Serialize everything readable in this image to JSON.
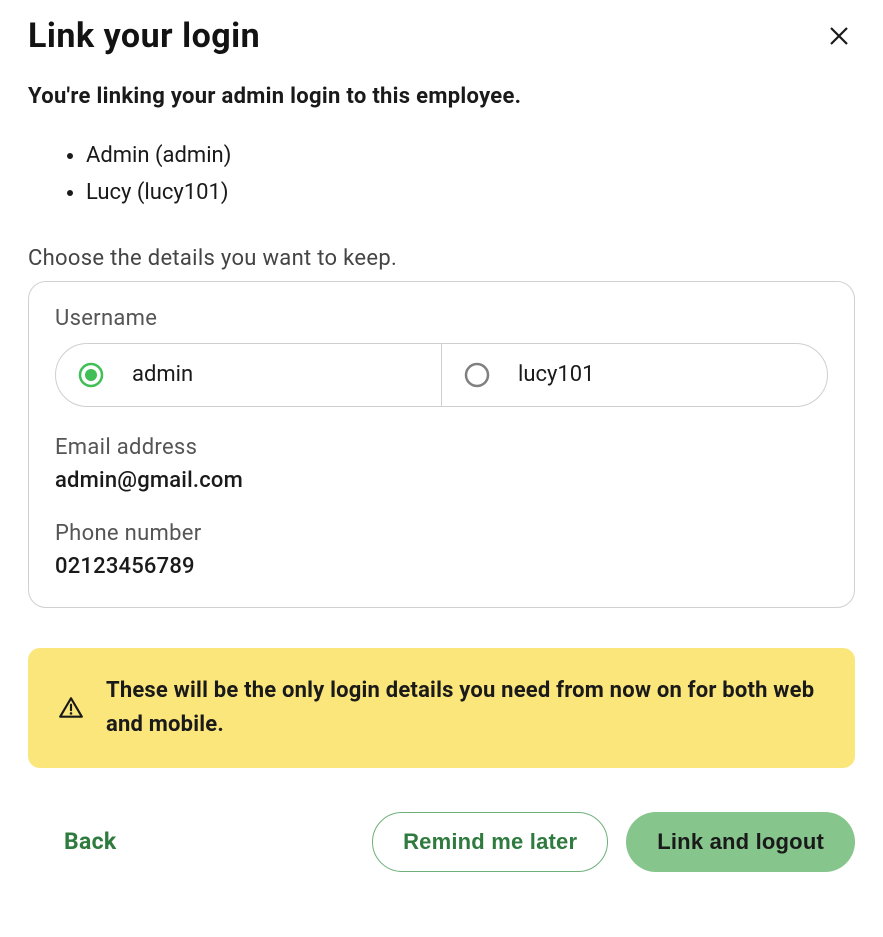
{
  "modal": {
    "title": "Link your login",
    "subtitle": "You're linking your admin login to this employee.",
    "employees": [
      "Admin (admin)",
      "Lucy (lucy101)"
    ],
    "choose_label": "Choose the details you want to keep.",
    "username_label": "Username",
    "username_options": {
      "selected": "admin",
      "other": "lucy101"
    },
    "email_label": "Email address",
    "email_value": "admin@gmail.com",
    "phone_label": "Phone number",
    "phone_value": "02123456789",
    "warning_text": "These will be the only login details you need from now on for both web and mobile.",
    "back_label": "Back",
    "remind_label": "Remind me later",
    "link_label": "Link and logout"
  }
}
